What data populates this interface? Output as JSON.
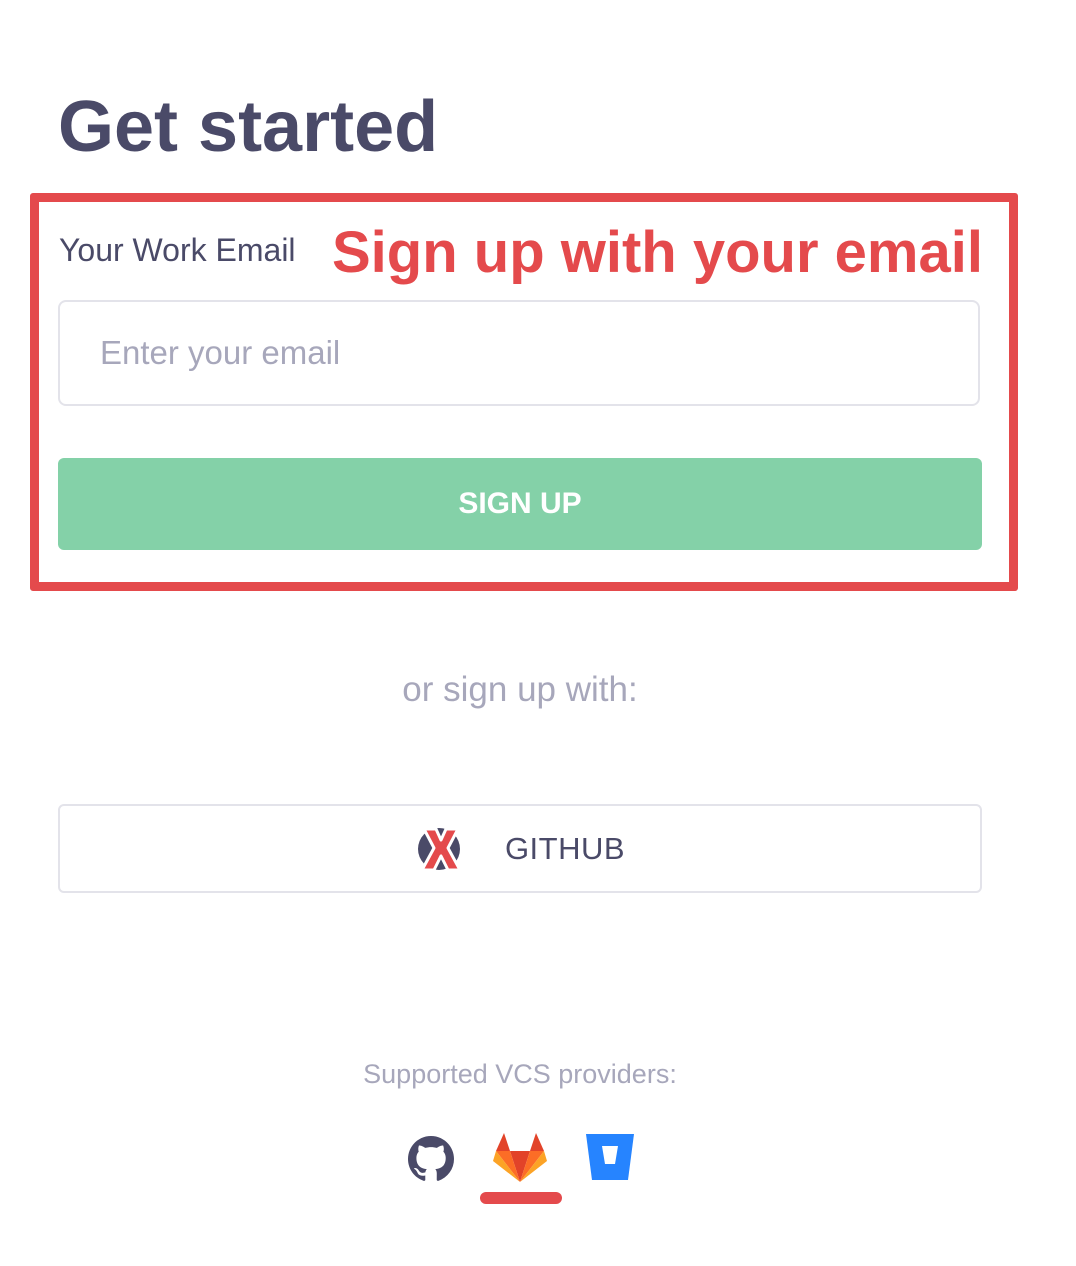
{
  "page": {
    "title": "Get started"
  },
  "signup_form": {
    "email_label": "Your Work Email",
    "email_placeholder": "Enter your email",
    "email_value": "",
    "signup_button_label": "SIGN UP"
  },
  "annotation": {
    "text": "Sign up with your email",
    "color": "#e44a4c"
  },
  "alt_signup": {
    "or_text": "or sign up with:",
    "github_button_label": "GITHUB",
    "github_button_icon": "x-mark-icon"
  },
  "vcs": {
    "label": "Supported VCS providers:",
    "providers": [
      {
        "name": "GitHub",
        "icon": "github-icon"
      },
      {
        "name": "GitLab",
        "icon": "gitlab-icon",
        "highlighted": true
      },
      {
        "name": "Bitbucket",
        "icon": "bitbucket-icon"
      }
    ]
  },
  "colors": {
    "text_dark": "#4a4a68",
    "text_muted": "#a7a7bb",
    "accent_green": "#84d1a8",
    "annotation_red": "#e44a4c",
    "border": "#e3e3ea"
  }
}
